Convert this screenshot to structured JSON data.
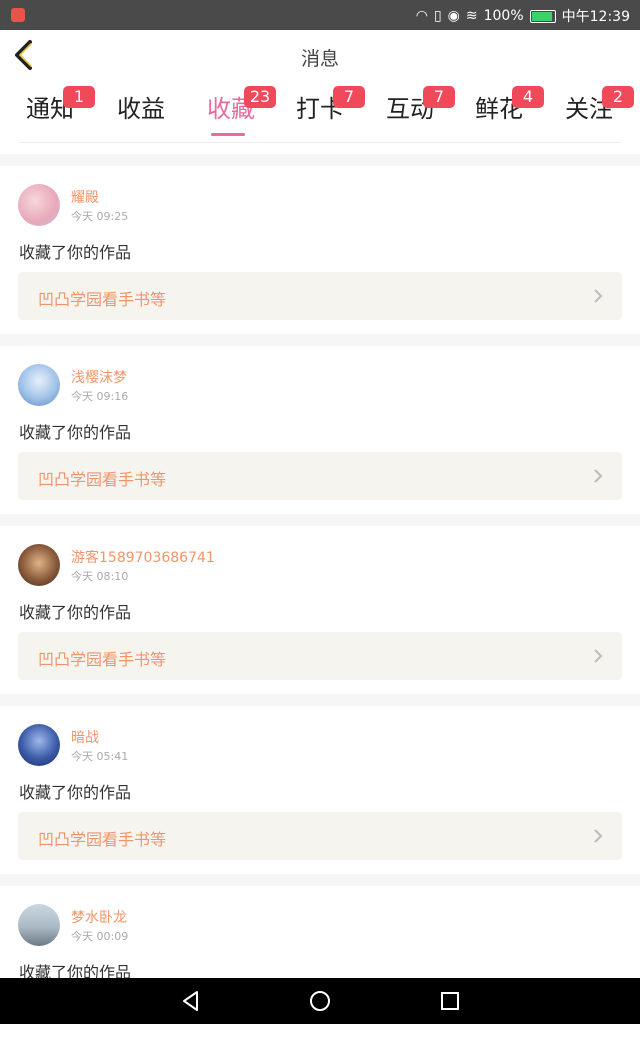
{
  "status": {
    "percent": "100%",
    "time": "中午12:39",
    "battery_level": 1.0
  },
  "header": {
    "title": "消息"
  },
  "tabs": [
    {
      "label": "通知",
      "badge": "1"
    },
    {
      "label": "收益",
      "badge": ""
    },
    {
      "label": "收藏",
      "badge": "23"
    },
    {
      "label": "打卡",
      "badge": "7"
    },
    {
      "label": "互动",
      "badge": "7"
    },
    {
      "label": "鲜花",
      "badge": "4"
    },
    {
      "label": "关注",
      "badge": "2"
    }
  ],
  "active_tab": "收藏",
  "colors": {
    "accent": "#e86a9e",
    "badge": "#f04a5a",
    "name": "#f0956a"
  },
  "items": [
    {
      "name": "耀殿",
      "time": "今天 09:25",
      "action": "收藏了你的作品",
      "work": "凹凸学园看手书等"
    },
    {
      "name": "浅樱沫梦",
      "time": "今天 09:16",
      "action": "收藏了你的作品",
      "work": "凹凸学园看手书等"
    },
    {
      "name": "游客1589703686741",
      "time": "今天 08:10",
      "action": "收藏了你的作品",
      "work": "凹凸学园看手书等"
    },
    {
      "name": "暗战",
      "time": "今天 05:41",
      "action": "收藏了你的作品",
      "work": "凹凸学园看手书等"
    },
    {
      "name": "梦水卧龙",
      "time": "今天 00:09",
      "action": "收藏了你的作品",
      "work": ""
    }
  ]
}
